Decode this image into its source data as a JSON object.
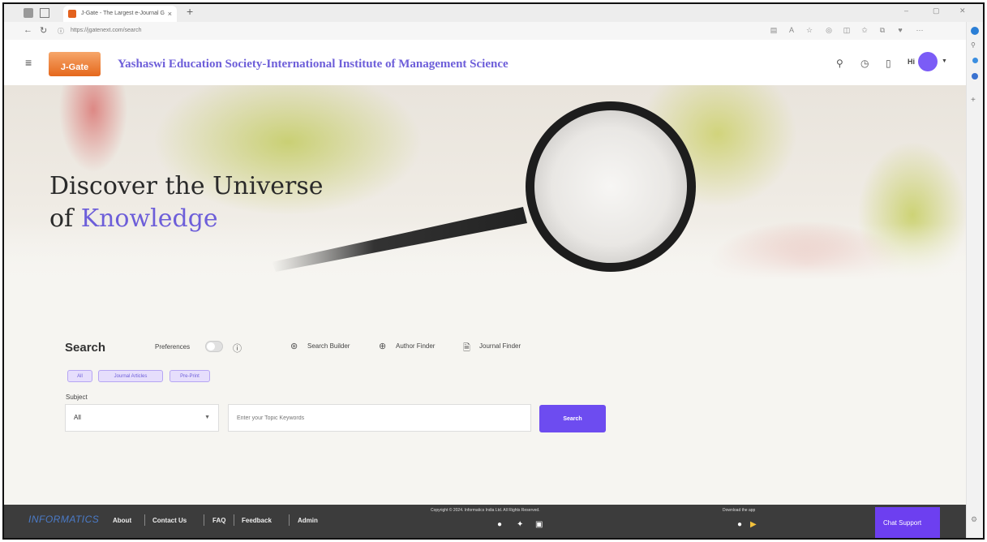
{
  "browser": {
    "tab_title": "J-Gate - The Largest e-Journal G",
    "url": "https://jgatenext.com/search"
  },
  "header": {
    "logo_text": "J-Gate",
    "institution": "Yashaswi Education Society-International Institute of Management Science",
    "greeting": "Hi"
  },
  "hero": {
    "line1": "Discover the Universe",
    "line2_prefix": "of ",
    "line2_accent": "Knowledge"
  },
  "search": {
    "heading": "Search",
    "preferences_label": "Preferences",
    "tools": [
      "Search Builder",
      "Author Finder",
      "Journal Finder"
    ],
    "chips": [
      "All",
      "Journal Articles",
      "Pre-Print"
    ],
    "subject_label": "Subject",
    "subject_value": "All",
    "keyword_placeholder": "Enter your Topic Keywords",
    "button_label": "Search"
  },
  "footer": {
    "brand": "INFORMATICS",
    "links": [
      "About",
      "Contact Us",
      "FAQ",
      "Feedback",
      "Admin"
    ],
    "copyright": "Copyright © 2024. Informatics India Ltd. All Rights Reserved.",
    "download_label": "Download the app",
    "chat_support": "Chat Support"
  },
  "colors": {
    "accent": "#6d5ed9",
    "button": "#6d4cf0",
    "footer_bg": "#3c3c3c",
    "logo": "#e5681c"
  },
  "icons": [
    "menu-icon",
    "search-icon",
    "history-icon",
    "bookmark-icon",
    "info-icon",
    "search-builder-icon",
    "author-finder-icon",
    "journal-finder-icon",
    "github-icon",
    "twitter-icon",
    "linkedin-icon",
    "apple-icon",
    "play-store-icon"
  ]
}
